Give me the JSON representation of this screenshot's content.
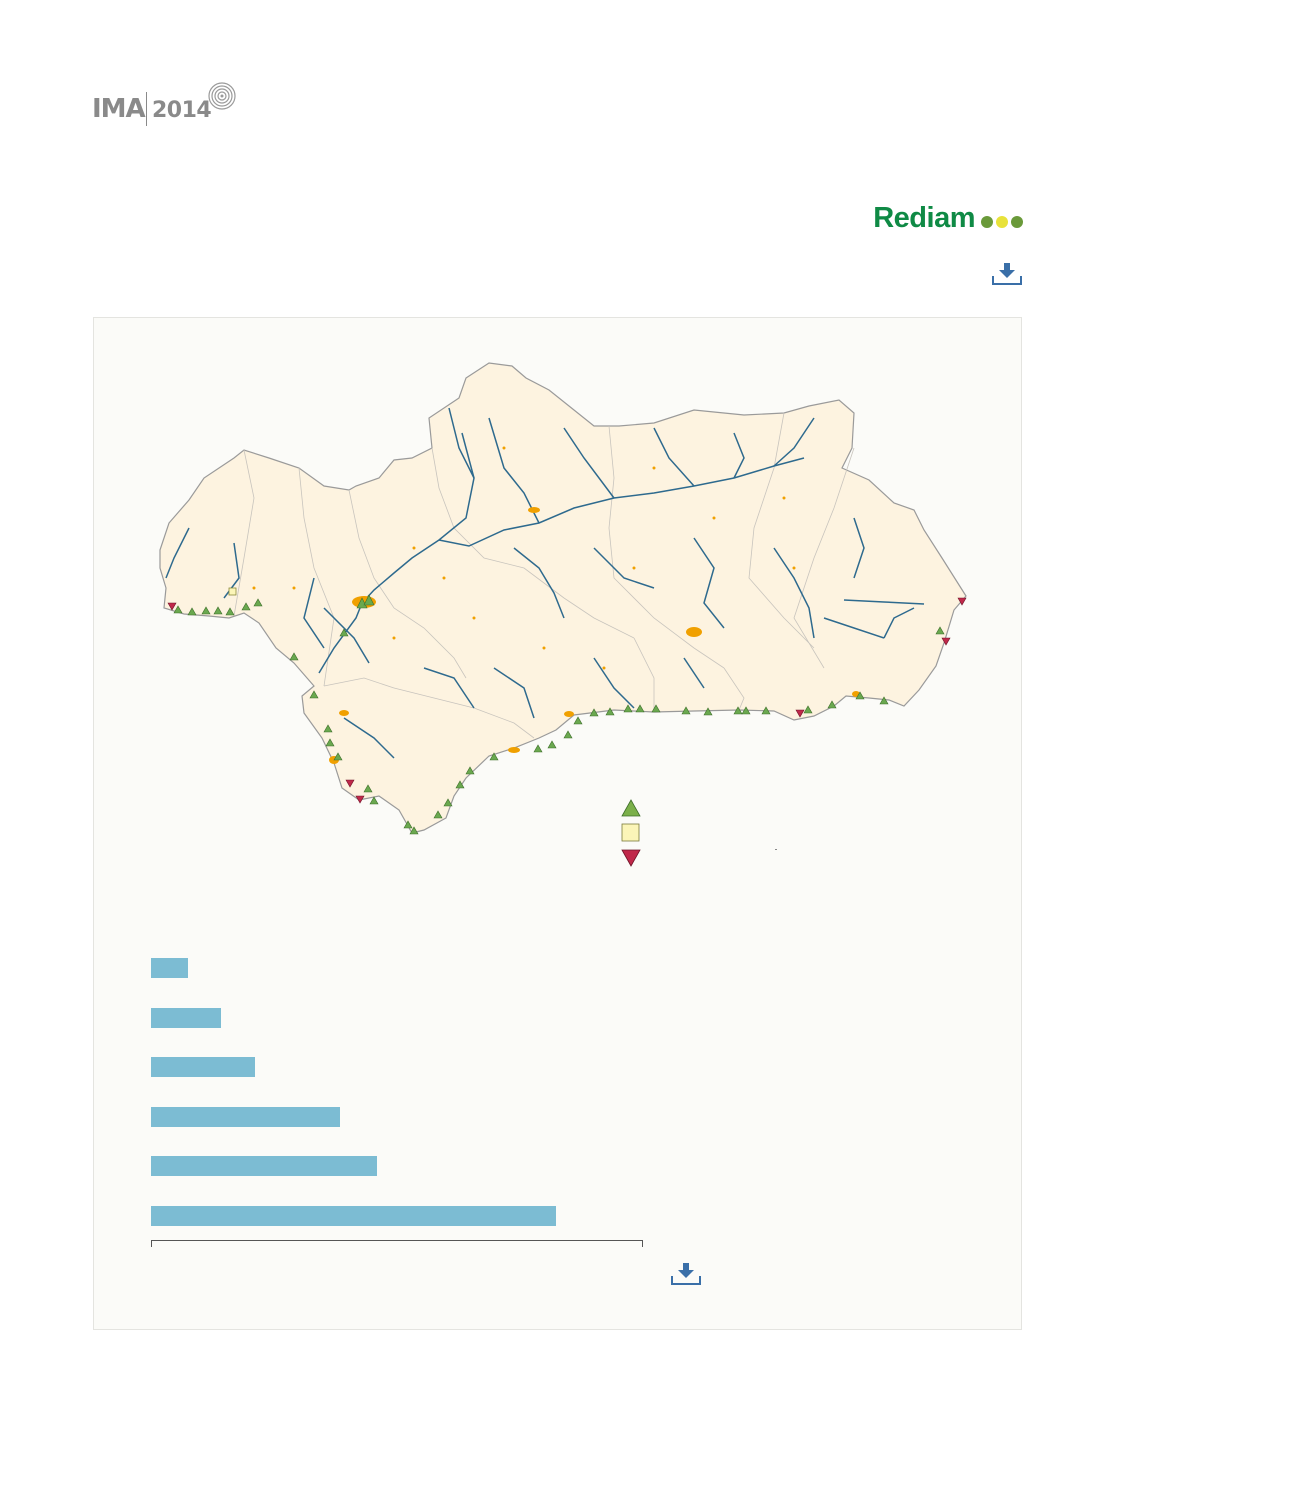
{
  "header": {
    "logo_ima": "IMA",
    "logo_year": "2014",
    "brand": "Rediam",
    "brand_dot_colors": [
      "#6a9a3a",
      "#e8e23a",
      "#6a9a3a"
    ],
    "download_icon": "download-icon"
  },
  "map": {
    "region_fill": "#fdf3e0",
    "river_color": "#2e6a8e",
    "urban_color": "#f0a000",
    "legend": {
      "items": [
        {
          "symbol": "triangle-up",
          "color": "#7bb04a"
        },
        {
          "symbol": "square",
          "color": "#fbf5b8"
        },
        {
          "symbol": "triangle-down",
          "color": "#c0284a"
        }
      ]
    }
  },
  "chart_data": {
    "type": "bar",
    "orientation": "horizontal",
    "values": [
      37,
      70,
      104,
      189,
      226,
      405
    ],
    "xlim": [
      0,
      492
    ],
    "bar_color": "#7cbcd3",
    "grid": false
  },
  "chart_download_icon": "download-icon"
}
